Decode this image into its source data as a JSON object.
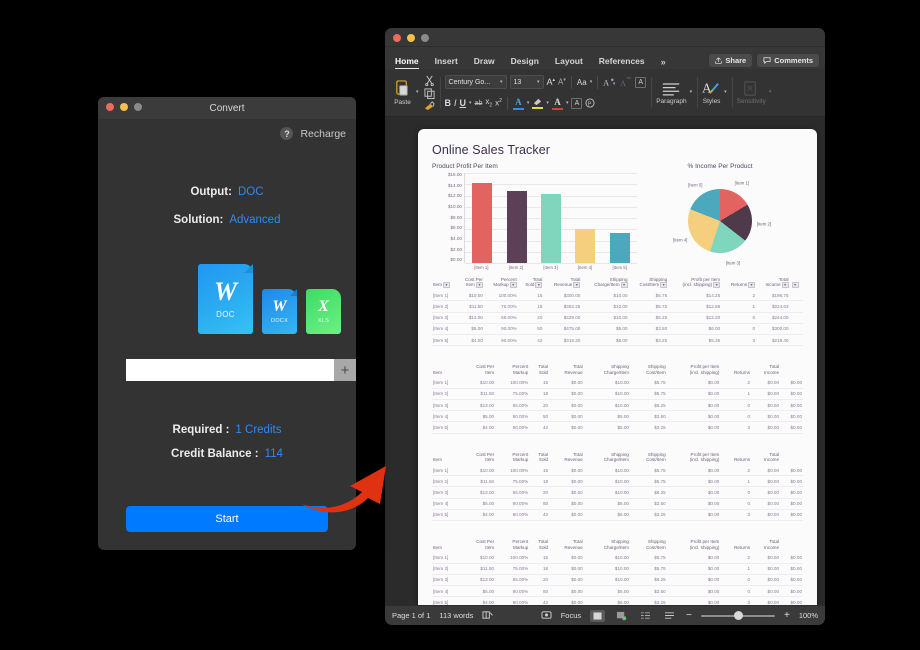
{
  "convert_window": {
    "title": "Convert",
    "help_icon": "?",
    "recharge_label": "Recharge",
    "output_label": "Output:",
    "output_value": "DOC",
    "solution_label": "Solution:",
    "solution_value": "Advanced",
    "formats": [
      {
        "letter": "W",
        "label": "DOC",
        "color": "#29a8f0",
        "selected": true
      },
      {
        "letter": "W",
        "label": "DOCX",
        "color": "#2b9fef",
        "selected": false
      },
      {
        "letter": "X",
        "label": "XLS",
        "color": "#5ae877",
        "selected": false
      }
    ],
    "path_value": "",
    "path_placeholder": "",
    "add_button_label": "+",
    "required_label": "Required :",
    "required_value": "1 Credits",
    "balance_label": "Credit Balance :",
    "balance_value": "114",
    "start_label": "Start",
    "accent_color": "#007aff",
    "link_color": "#2e8bf0"
  },
  "word_window": {
    "tabs": [
      {
        "label": "Home",
        "active": true
      },
      {
        "label": "Insert",
        "active": false
      },
      {
        "label": "Draw",
        "active": false
      },
      {
        "label": "Design",
        "active": false
      },
      {
        "label": "Layout",
        "active": false
      },
      {
        "label": "References",
        "active": false
      }
    ],
    "overflow_icon": "»",
    "share_label": "Share",
    "comments_label": "Comments",
    "font_name": "Century Go...",
    "font_size": "13",
    "grow_font": "A",
    "shrink_font": "A",
    "change_case": "Aa",
    "bold": "B",
    "italic": "I",
    "underline": "U",
    "strikethrough": "ab",
    "subscript": "x",
    "superscript": "x",
    "paste_label": "Paste",
    "paragraph_label": "Paragraph",
    "styles_label": "Styles",
    "sensitivity_label": "Sensitivity",
    "status": {
      "page": "Page 1 of 1",
      "words": "113 words",
      "focus": "Focus",
      "zoom": "100%",
      "zoom_out": "−",
      "zoom_in": "+"
    }
  },
  "document": {
    "title": "Online Sales Tracker",
    "table_columns": [
      "Item",
      "Cost Per Item",
      "Percent Markup",
      "Total Sold",
      "Total Revenue",
      "Shipping Charge/Item",
      "Shipping Cost/Item",
      "Profit per Item (incl. shipping)",
      "Returns",
      "Total Income"
    ],
    "table_columns_wrapped": [
      [
        "Item",
        ""
      ],
      [
        "Cost Per",
        "Item"
      ],
      [
        "Percent",
        "Markup"
      ],
      [
        "Total",
        "Sold"
      ],
      [
        "Total",
        "Revenue"
      ],
      [
        "Shipping",
        "Charge/Item"
      ],
      [
        "Shipping",
        "Cost/Item"
      ],
      [
        "Profit per Item",
        "(incl. shipping)"
      ],
      [
        "Returns",
        ""
      ],
      [
        "Total",
        "Income"
      ]
    ],
    "table_primary": [
      [
        "[Item 1]",
        "$10.00",
        "100.00%",
        "15",
        "$300.00",
        "$10.00",
        "$5.75",
        "$14.25",
        "2",
        "$196.75"
      ],
      [
        "[Item 2]",
        "$11.50",
        "75.00%",
        "18",
        "$362.25",
        "$10.00",
        "$5.75",
        "$12.88",
        "1",
        "$224.63"
      ],
      [
        "[Item 3]",
        "$13.00",
        "65.00%",
        "20",
        "$429.00",
        "$10.00",
        "$6.25",
        "$12.20",
        "0",
        "$244.00"
      ],
      [
        "[Item 4]",
        "$5.00",
        "90.00%",
        "50",
        "$475.00",
        "$5.00",
        "$3.50",
        "$6.00",
        "0",
        "$300.00"
      ],
      [
        "[Item 5]",
        "$4.00",
        "90.00%",
        "42",
        "$319.20",
        "$5.00",
        "$3.25",
        "$5.35",
        "3",
        "$218.40"
      ]
    ],
    "table_empty": [
      [
        "[Item 1]",
        "$10.00",
        "100.00%",
        "15",
        "$0.00",
        "$10.00",
        "$5.75",
        "$0.00",
        "2",
        "$0.00"
      ],
      [
        "[Item 2]",
        "$11.50",
        "75.00%",
        "18",
        "$0.00",
        "$10.00",
        "$5.75",
        "$0.00",
        "1",
        "$0.00"
      ],
      [
        "[Item 3]",
        "$13.00",
        "65.00%",
        "20",
        "$0.00",
        "$10.00",
        "$6.25",
        "$0.00",
        "0",
        "$0.00"
      ],
      [
        "[Item 4]",
        "$5.00",
        "90.00%",
        "50",
        "$0.00",
        "$5.00",
        "$3.50",
        "$0.00",
        "0",
        "$0.00"
      ],
      [
        "[Item 5]",
        "$4.00",
        "90.00%",
        "42",
        "$0.00",
        "$5.00",
        "$3.25",
        "$0.00",
        "3",
        "$0.00"
      ]
    ],
    "filter_icon": "▼"
  },
  "chart_data": [
    {
      "type": "bar",
      "title": "Product Profit Per Item",
      "categories": [
        "[Item 1]",
        "[Item 2]",
        "[Item 3]",
        "[Item 4]",
        "[Item 5]"
      ],
      "values": [
        14.25,
        12.88,
        12.2,
        6.0,
        5.35
      ],
      "colors": [
        "#e2635f",
        "#5c4057",
        "#7fd6bd",
        "#f5cf7e",
        "#4ba8bd"
      ],
      "xlabel": "",
      "ylabel": "",
      "ylim": [
        0,
        16
      ],
      "yticks": [
        "$16.00",
        "$14.00",
        "$12.00",
        "$10.00",
        "$8.00",
        "$6.00",
        "$4.00",
        "$2.00",
        "$0.00"
      ],
      "grid": true,
      "legend": "none"
    },
    {
      "type": "pie",
      "title": "% Income Per Product",
      "labels": [
        "[Item 1]",
        "[Item 2]",
        "[Item 3]",
        "[Item 4]",
        "[Item 5]"
      ],
      "values": [
        16.5,
        19.0,
        19.5,
        26.0,
        19.0
      ],
      "colors": [
        "#e2635f",
        "#4f3a4c",
        "#7fd6bd",
        "#f5cf7e",
        "#4ba8bd"
      ],
      "legend": "labels-outside"
    }
  ],
  "annotation": {
    "arrow_color": "#e03211",
    "arrow_target": "start-button"
  }
}
